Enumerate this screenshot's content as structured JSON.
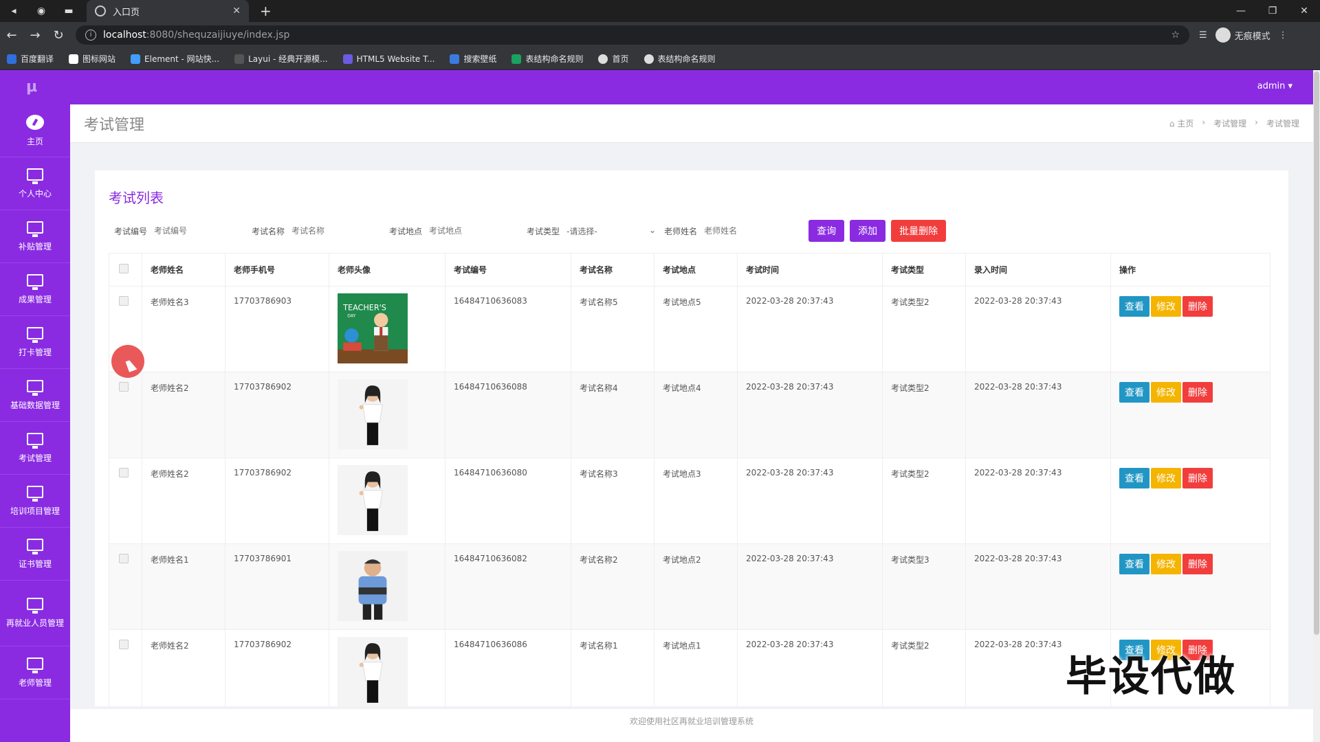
{
  "browser": {
    "tab_title": "入口页",
    "url_host": "localhost",
    "url_path": ":8080/shequzaijiuye/index.jsp",
    "incognito": "无痕模式",
    "bookmarks": [
      "百度翻译",
      "图标网站",
      "Element - 网站快...",
      "Layui - 经典开源模...",
      "HTML5 Website T...",
      "搜索壁纸",
      "表结构命名规则",
      "首页",
      "表结构命名规则"
    ]
  },
  "app": {
    "logo": "μ",
    "user": "admin ▾",
    "sidebar": [
      "主页",
      "个人中心",
      "补贴管理",
      "成果管理",
      "打卡管理",
      "基础数据管理",
      "考试管理",
      "培训项目管理",
      "证书管理",
      "再就业人员管理",
      "老师管理"
    ],
    "page_title": "考试管理",
    "breadcrumb": [
      "⌂ 主页",
      "›",
      "考试管理",
      "›",
      "考试管理"
    ],
    "panel_title": "考试列表",
    "filters": {
      "exam_no_label": "考试编号",
      "exam_no_ph": "考试编号",
      "exam_name_label": "考试名称",
      "exam_name_ph": "考试名称",
      "exam_place_label": "考试地点",
      "exam_place_ph": "考试地点",
      "exam_type_label": "考试类型",
      "exam_type_value": "-请选择-",
      "teacher_label": "老师姓名",
      "teacher_ph": "老师姓名",
      "search": "查询",
      "add": "添加",
      "batch_delete": "批量删除"
    },
    "columns": [
      "老师姓名",
      "老师手机号",
      "老师头像",
      "考试编号",
      "考试名称",
      "考试地点",
      "考试时间",
      "考试类型",
      "录入时间",
      "操作"
    ],
    "rows": [
      {
        "name": "老师姓名3",
        "phone": "17703786903",
        "avatar": "teachers-day-poster",
        "no": "16484710636083",
        "exam": "考试名称5",
        "place": "考试地点5",
        "time": "2022-03-28 20:37:43",
        "type": "考试类型2",
        "created": "2022-03-28 20:37:43"
      },
      {
        "name": "老师姓名2",
        "phone": "17703786902",
        "avatar": "woman-teacher-photo",
        "no": "16484710636088",
        "exam": "考试名称4",
        "place": "考试地点4",
        "time": "2022-03-28 20:37:43",
        "type": "考试类型2",
        "created": "2022-03-28 20:37:43"
      },
      {
        "name": "老师姓名2",
        "phone": "17703786902",
        "avatar": "woman-teacher-photo",
        "no": "16484710636080",
        "exam": "考试名称3",
        "place": "考试地点3",
        "time": "2022-03-28 20:37:43",
        "type": "考试类型2",
        "created": "2022-03-28 20:37:43"
      },
      {
        "name": "老师姓名1",
        "phone": "17703786901",
        "avatar": "man-teacher-photo",
        "no": "16484710636082",
        "exam": "考试名称2",
        "place": "考试地点2",
        "time": "2022-03-28 20:37:43",
        "type": "考试类型3",
        "created": "2022-03-28 20:37:43"
      },
      {
        "name": "老师姓名2",
        "phone": "17703786902",
        "avatar": "woman-teacher-photo",
        "no": "16484710636086",
        "exam": "考试名称1",
        "place": "考试地点1",
        "time": "2022-03-28 20:37:43",
        "type": "考试类型2",
        "created": "2022-03-28 20:37:43"
      }
    ],
    "ops": {
      "view": "查看",
      "edit": "修改",
      "del": "删除"
    },
    "footer": "欢迎使用社区再就业培训管理系统",
    "watermark": "毕设代做"
  },
  "colors": {
    "brand": "#8a2be2",
    "view": "#2196c4",
    "edit": "#f5b400",
    "danger": "#f23d3d"
  }
}
